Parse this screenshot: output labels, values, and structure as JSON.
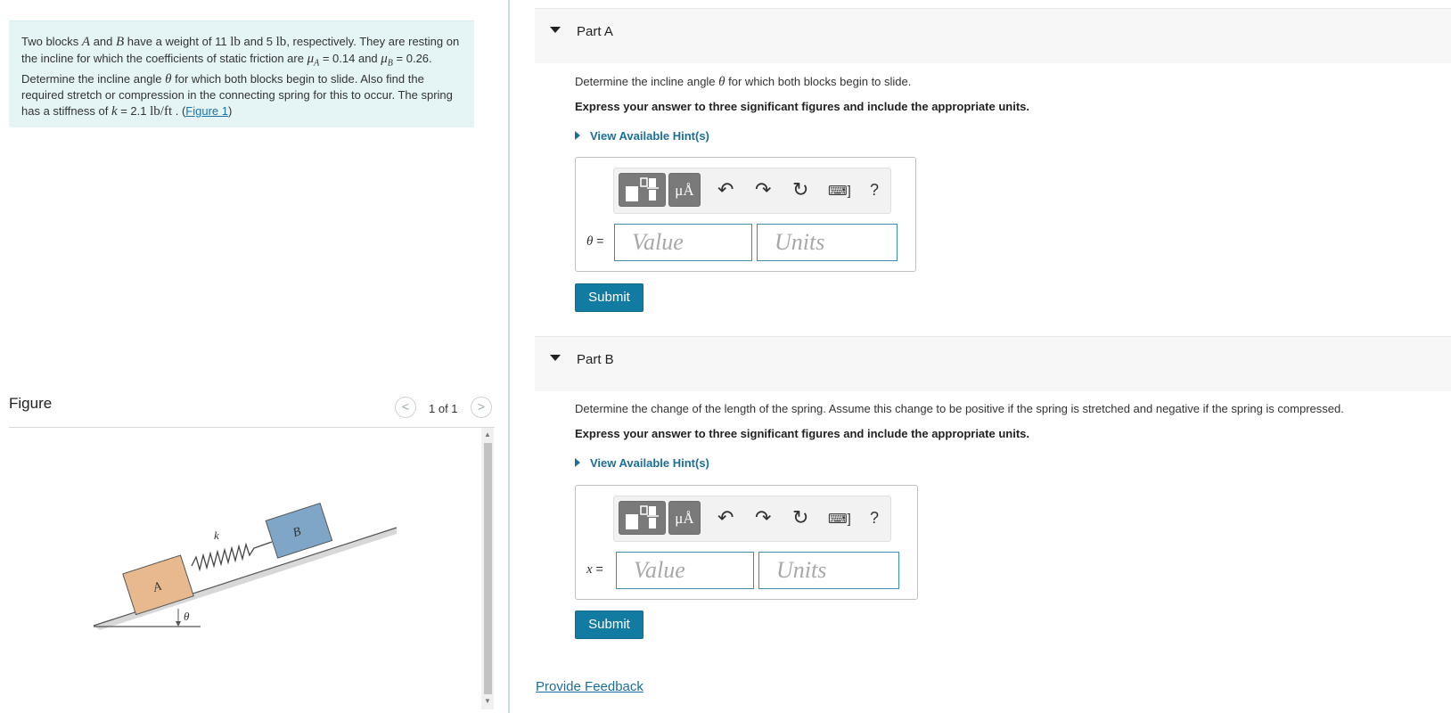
{
  "problem": {
    "t1": "Two blocks ",
    "A": "A",
    "t2": " and ",
    "B": "B",
    "t3": " have a weight of 11 ",
    "lb1": "lb",
    "t4": " and 5 ",
    "lb2": "lb",
    "t5": ", respectively. They are resting on the incline for which the coefficients of static friction are ",
    "muA": "μ",
    "subA": "A",
    "t6": " = 0.14 and ",
    "muB": "μ",
    "subB": "B",
    "t7": " = 0.26. Determine the incline angle ",
    "theta": "θ",
    "t8": " for which both blocks begin to slide. Also find the required stretch or compression in the connecting spring for this to occur. The spring has a stiffness of ",
    "k": "k",
    "t9": " = 2.1 ",
    "unit": "lb/ft",
    "t10": " . (",
    "link": "Figure 1",
    "t11": ")"
  },
  "figure": {
    "title": "Figure",
    "count": "1 of 1",
    "prev": "<",
    "next": ">",
    "label_k": "k",
    "label_A": "A",
    "label_B": "B",
    "label_theta": "θ"
  },
  "parts": [
    {
      "title": "Part A",
      "question_pre": "Determine the incline angle ",
      "question_sym": "θ",
      "question_post": " for which both blocks begin to slide.",
      "instruction": "Express your answer to three significant figures and include the appropriate units.",
      "hint": "View Available Hint(s)",
      "var": "θ",
      "eq": " =",
      "value_placeholder": "Value",
      "units_placeholder": "Units",
      "submit": "Submit"
    },
    {
      "title": "Part B",
      "question_pre": "Determine the change of the length of  the spring. Assume this change to be positive if the spring is stretched and negative if the spring is compressed.",
      "question_sym": "",
      "question_post": "",
      "instruction": "Express your answer to three significant figures and include the appropriate units.",
      "hint": "View Available Hint(s)",
      "var": "x",
      "eq": " =",
      "value_placeholder": "Value",
      "units_placeholder": "Units",
      "submit": "Submit"
    }
  ],
  "toolbar": {
    "mu_label": "μÅ",
    "undo": "↶",
    "redo": "↷",
    "reset": "↻",
    "keyboard": "⌨]",
    "help": "?"
  },
  "feedback": "Provide Feedback"
}
